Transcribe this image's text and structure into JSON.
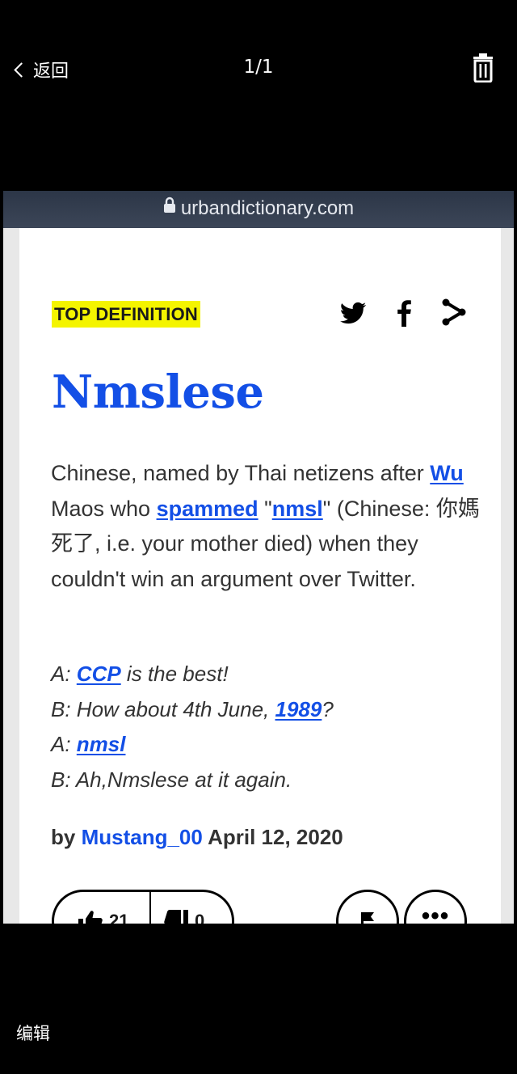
{
  "viewer": {
    "back_label": "返回",
    "counter": "1/1",
    "edit_label": "编辑",
    "icons": [
      "chevron-left-icon",
      "trash-icon"
    ]
  },
  "browser": {
    "url": "urbandictionary.com"
  },
  "definition": {
    "badge": "TOP DEFINITION",
    "word": "Nmslese",
    "meaning": {
      "p1": "Chinese, named by Thai netizens after ",
      "link_wu": "Wu",
      "p2": " Maos who ",
      "link_spammed": "spammed",
      "p3": " \"",
      "link_nmsl": "nmsl",
      "p4": "\" (Chinese: 你媽死了, i.e. your mother died) when they couldn't win an argument over Twitter."
    },
    "example": {
      "l1_prefix": "A: ",
      "l1_link": "CCP",
      "l1_suffix": " is the best!",
      "l2_prefix": "B: How about 4th June, ",
      "l2_link": "1989",
      "l2_suffix": "?",
      "l3_prefix": "A: ",
      "l3_link": "nmsl",
      "l4": "B: Ah,Nmslese at it again."
    },
    "author": {
      "by": "by ",
      "name": "Mustang_00",
      "date": " April 12, 2020"
    },
    "upvotes": "21",
    "downvotes": "0"
  },
  "colors": {
    "accent_blue": "#134fe6",
    "badge_yellow": "#f4f400",
    "url_bar": "#2f394b"
  }
}
